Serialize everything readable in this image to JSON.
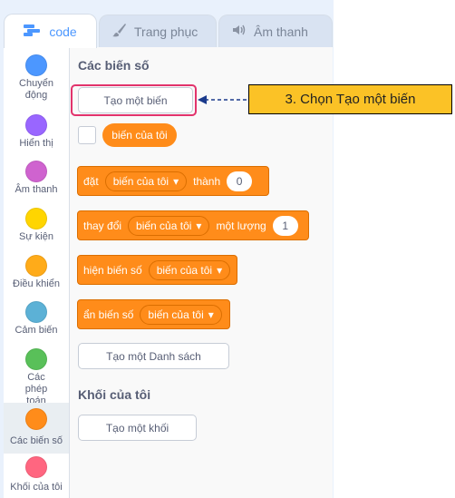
{
  "tabs": [
    {
      "label": "code",
      "icon": "code-icon"
    },
    {
      "label": "Trang phục",
      "icon": "brush-icon"
    },
    {
      "label": "Âm thanh",
      "icon": "speaker-icon"
    }
  ],
  "categories": [
    {
      "label": "Chuyển động",
      "color": "#4c97ff"
    },
    {
      "label": "Hiển thị",
      "color": "#9966ff"
    },
    {
      "label": "Âm thanh",
      "color": "#cf63cf"
    },
    {
      "label": "Sự kiện",
      "color": "#ffd500"
    },
    {
      "label": "Điều khiển",
      "color": "#ffab19"
    },
    {
      "label": "Cảm biến",
      "color": "#5cb1d6"
    },
    {
      "label": "Các phép toán",
      "color": "#59c059"
    },
    {
      "label": "Các biến số",
      "color": "#ff8c1a"
    },
    {
      "label": "Khối của tôi",
      "color": "#ff6680"
    }
  ],
  "palette": {
    "variables_header": "Các biến số",
    "make_variable": "Tạo một biến",
    "variable_reporter": "biến của tôi",
    "set_block": {
      "word": "đặt",
      "variable": "biến của tôi",
      "to": "thành",
      "value": "0"
    },
    "change_block": {
      "word": "thay đổi",
      "variable": "biến của tôi",
      "by": "một lượng",
      "value": "1"
    },
    "show_block": {
      "word": "hiện biến số",
      "variable": "biến của tôi"
    },
    "hide_block": {
      "word": "ẩn biến số",
      "variable": "biến của tôi"
    },
    "make_list": "Tạo một Danh sách",
    "my_blocks_header": "Khối của tôi",
    "make_block": "Tạo một khối"
  },
  "annotation": {
    "text": "3. Chọn Tạo một biến",
    "color": "#fbc226",
    "highlight_color": "#e2336c"
  }
}
